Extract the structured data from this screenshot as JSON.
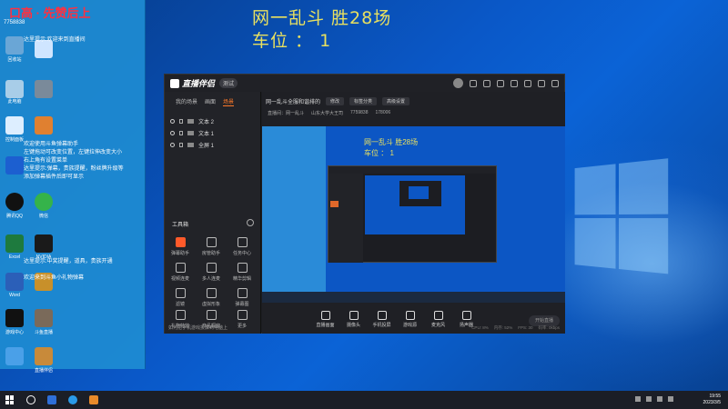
{
  "overlay": {
    "line1": "网一乱斗 胜28场",
    "line2": "车位 ： 1"
  },
  "left_panel": {
    "header": "口高 · 先赞后上",
    "id": "7758838",
    "messages": [
      "达里提示:欢迎来到直播间",
      "欢迎使用斗鱼弹幕助手",
      "左键拖动可改变位置，左键拉伸改变大小",
      "右上角有设置菜单",
      "达里提示:弹幕，贵族提醒，粉丝牌升级等",
      "添加弹幕插件后即可显示",
      "达里提示:中奖提醒，道具，贵族开通",
      "欢迎来到斗鱼小礼物弹幕"
    ],
    "desktop_labels": [
      "回收站",
      "此电脑",
      "控制面板",
      "腾讯QQ",
      "微信",
      "Excel",
      "NVIDIA",
      "Word",
      "游戏中心",
      "斗鱼直播",
      "直播伴侣"
    ]
  },
  "app": {
    "name": "直播伴侣",
    "version": "测试",
    "tabs": [
      "我的场景",
      "画面",
      "场景"
    ],
    "active_tab": 2,
    "sources": [
      "文本 2",
      "文本 1",
      "全屏 1"
    ],
    "tools_title": "工具箱",
    "tools": [
      "弹幕助手",
      "房管助手",
      "任务中心",
      "视频连麦",
      "多人连麦",
      "精华剪辑",
      "滤镜",
      "虚拟形象",
      "弹幕图",
      "礼物特效",
      "商品橱窗",
      "更多"
    ],
    "side_footer": "如何把手机游戏投屏到电脑上",
    "stream_title": "网一乱斗全服和谐排的",
    "chips": [
      "修改",
      "标签分类",
      "高级设置"
    ],
    "info": [
      "直播间：网一乱斗",
      "山东大学大王司",
      "7759838",
      "178006"
    ],
    "controls": [
      "直播画面",
      "摄像头",
      "手机投屏",
      "游戏源",
      "麦克风",
      "扬声器"
    ],
    "start_button": "开始直播",
    "stats": [
      "CPU: 8%",
      "内存: 52%",
      "FPS: 30",
      "码率: 0kbps"
    ]
  },
  "preview": {
    "text1": "网一乱斗 胜28场",
    "text2": "车位 ： 1"
  },
  "taskbar": {
    "time": "19:55",
    "date": "2023/3/5"
  }
}
